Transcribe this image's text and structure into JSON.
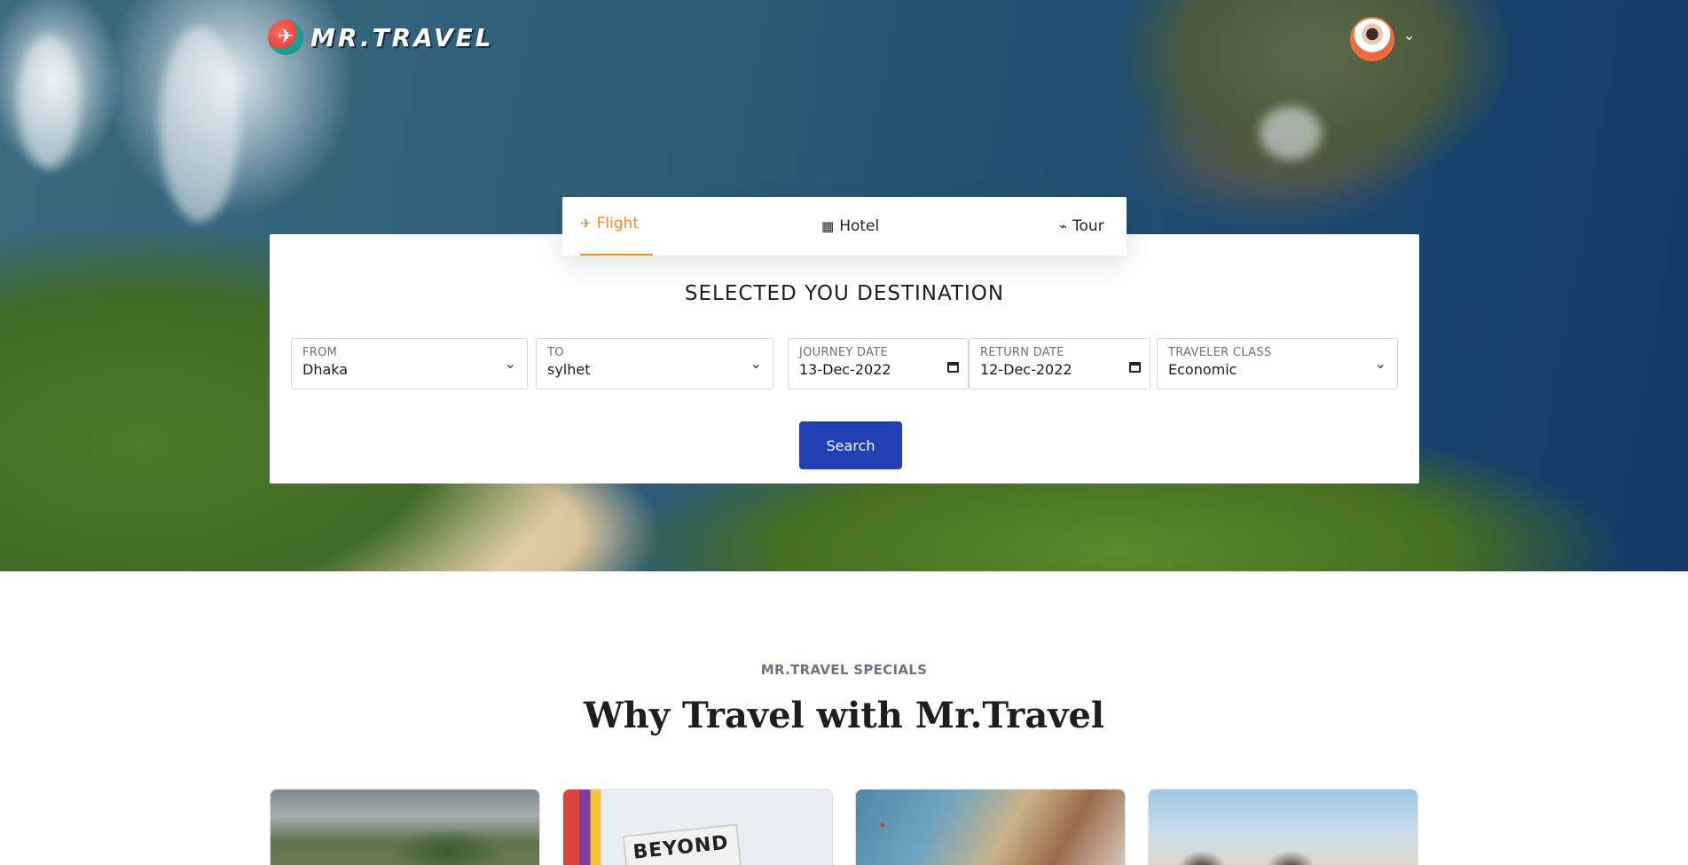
{
  "brand": {
    "name": "MR.TRAVEL"
  },
  "tabs": [
    {
      "label": "Flight",
      "icon": "plane-icon",
      "active": true
    },
    {
      "label": "Hotel",
      "icon": "hotel-icon",
      "active": false
    },
    {
      "label": "Tour",
      "icon": "palm-tree-icon",
      "active": false
    }
  ],
  "search": {
    "title": "SELECTED YOU DESTINATION",
    "from": {
      "label": "FROM",
      "value": "Dhaka"
    },
    "to": {
      "label": "TO",
      "value": "sylhet"
    },
    "journey_date": {
      "label": "JOURNEY DATE",
      "value": "13-Dec-2022"
    },
    "return_date": {
      "label": "RETURN DATE",
      "value": "12-Dec-2022"
    },
    "traveler_class": {
      "label": "TRAVELER CLASS",
      "value": "Economic"
    },
    "button_label": "Search"
  },
  "specials": {
    "eyebrow": "MR.TRAVEL SPECIALS",
    "title": "Why Travel with Mr.Travel",
    "card_2_sign": "BEYOND"
  },
  "colors": {
    "accent": "#f28c1f",
    "primary_button": "#2140b3"
  }
}
